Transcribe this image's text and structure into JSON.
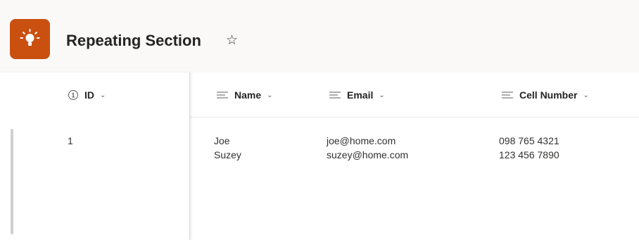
{
  "app": {
    "title": "Repeating Section",
    "favorite_glyph": "☆",
    "icon": "lightbulb-icon",
    "accent_color": "#ca5010"
  },
  "columns": [
    {
      "label": "ID",
      "icon": "number-type-icon"
    },
    {
      "label": "Name",
      "icon": "text-type-icon"
    },
    {
      "label": "Email",
      "icon": "text-type-icon"
    },
    {
      "label": "Cell Number",
      "icon": "text-type-icon"
    }
  ],
  "sort_glyph": "⌄",
  "rows": [
    {
      "id": "1",
      "name_lines": [
        "Joe",
        "Suzey"
      ],
      "email_lines": [
        "joe@home.com",
        "suzey@home.com"
      ],
      "phone_lines": [
        "098 765 4321",
        "123 456 7890"
      ]
    }
  ]
}
